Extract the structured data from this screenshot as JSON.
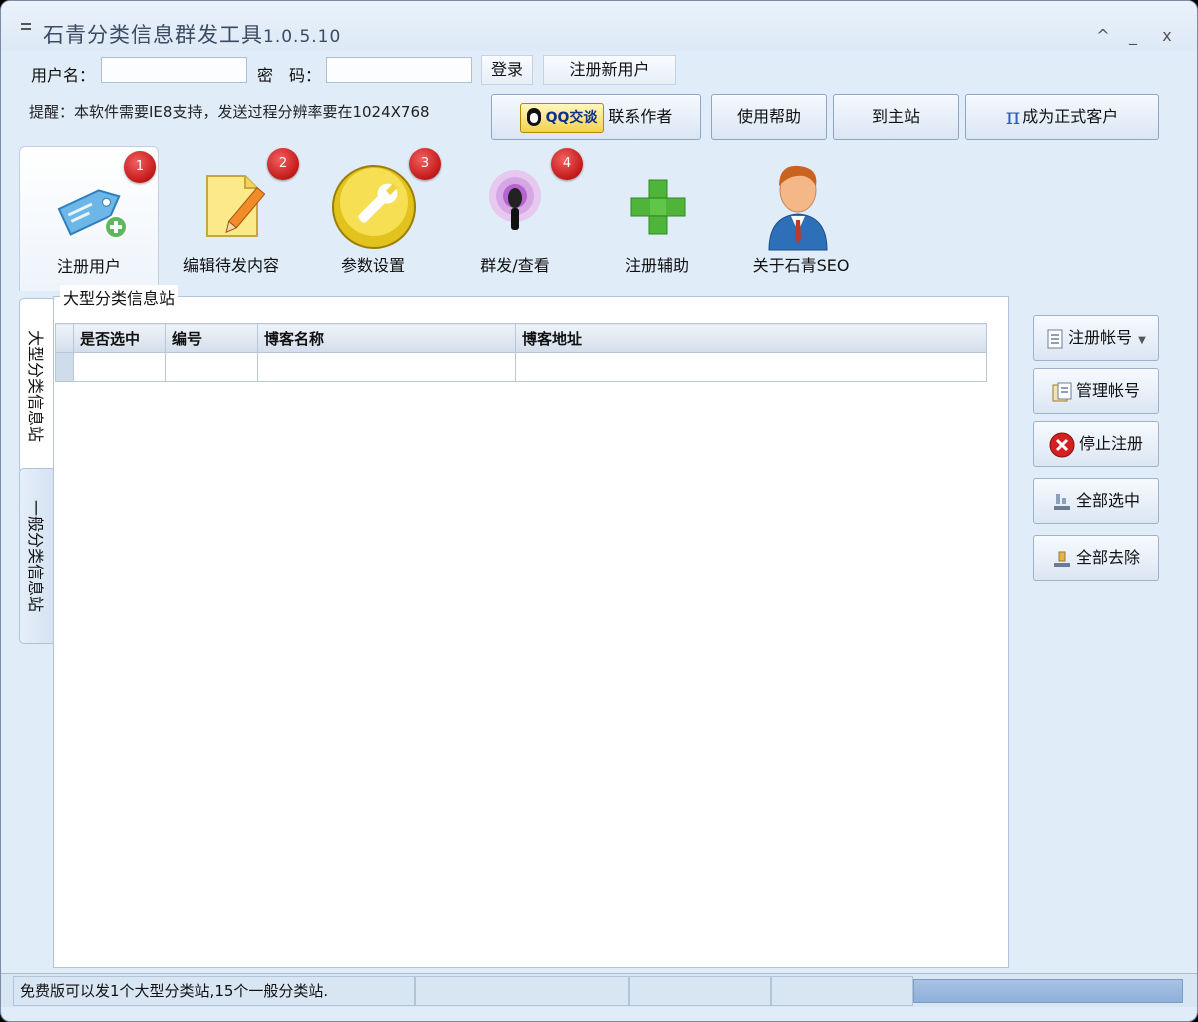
{
  "window": {
    "title": "石青分类信息群发工具",
    "version": "1.0.5.10",
    "controls": {
      "minimize": "_",
      "maximize": "^",
      "close": "x"
    }
  },
  "login": {
    "username_label": "用户名：",
    "username_value": "",
    "password_label": "密　码：",
    "password_value": "",
    "login_button": "登录",
    "register_button": "注册新用户"
  },
  "notice": "提醒：本软件需要IE8支持，发送过程分辨率要在1024X768",
  "top_buttons": {
    "qq_badge": "QQ交谈",
    "contact": "联系作者",
    "help": "使用帮助",
    "home": "到主站",
    "vip_symbol": "π",
    "vip": "成为正式客户"
  },
  "tools": [
    {
      "label": "注册用户",
      "badge": "1",
      "icon": "tag-add-icon"
    },
    {
      "label": "编辑待发内容",
      "badge": "2",
      "icon": "note-edit-icon"
    },
    {
      "label": "参数设置",
      "badge": "3",
      "icon": "wrench-icon"
    },
    {
      "label": "群发/查看",
      "badge": "4",
      "icon": "broadcast-icon"
    },
    {
      "label": "注册辅助",
      "icon": "green-plus-icon"
    },
    {
      "label": "关于石青SEO",
      "icon": "user-avatar-icon"
    }
  ],
  "side_tabs": [
    "大型分类信息站",
    "一般分类信息站"
  ],
  "panel": {
    "group_title": "大型分类信息站",
    "columns": [
      "是否选中",
      "编号",
      "博客名称",
      "博客地址"
    ]
  },
  "actions": {
    "register_account": "注册帐号",
    "manage_account": "管理帐号",
    "stop_register": "停止注册",
    "select_all": "全部选中",
    "deselect_all": "全部去除"
  },
  "status": {
    "message": "免费版可以发1个大型分类站,15个一般分类站.",
    "progress": 1.0
  },
  "colors": {
    "accent": "#2d5fb4",
    "badge_red": "#c31818",
    "window_bg": "#e0ecf8"
  }
}
